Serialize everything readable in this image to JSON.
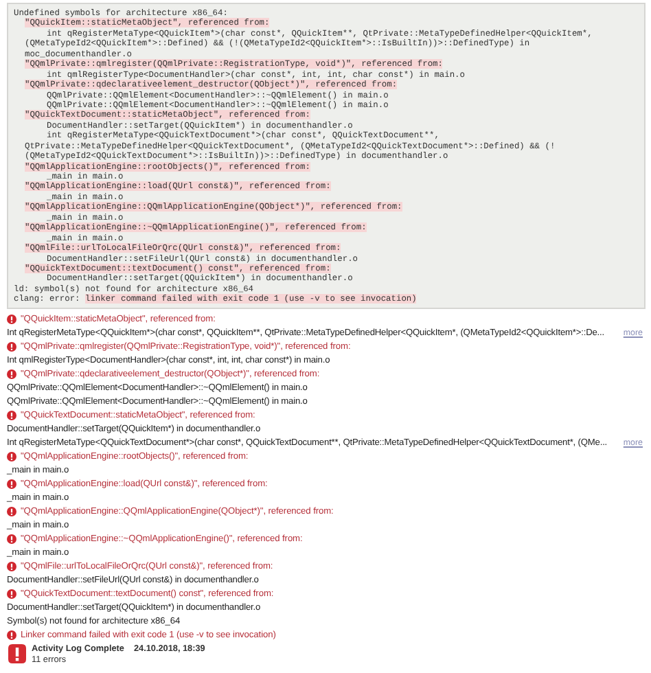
{
  "build_log": {
    "lines": [
      {
        "kind": "plain",
        "text": "Undefined symbols for architecture x86_64:"
      },
      {
        "kind": "symbol",
        "text": "\"QQuickItem::staticMetaObject\", referenced from:"
      },
      {
        "kind": "ref",
        "text": "int qRegisterMetaType<QQuickItem*>(char const*, QQuickItem**, QtPrivate::MetaTypeDefinedHelper<QQuickItem*,"
      },
      {
        "kind": "cont",
        "text": "(QMetaTypeId2<QQuickItem*>::Defined) && (!(QMetaTypeId2<QQuickItem*>::IsBuiltIn))>::DefinedType) in"
      },
      {
        "kind": "cont",
        "text": "moc_documenthandler.o"
      },
      {
        "kind": "symbol",
        "text": "\"QQmlPrivate::qmlregister(QQmlPrivate::RegistrationType, void*)\", referenced from:"
      },
      {
        "kind": "ref",
        "text": "int qmlRegisterType<DocumentHandler>(char const*, int, int, char const*) in main.o"
      },
      {
        "kind": "symbol",
        "text": "\"QQmlPrivate::qdeclarativeelement_destructor(QObject*)\", referenced from:"
      },
      {
        "kind": "ref",
        "text": "QQmlPrivate::QQmlElement<DocumentHandler>::~QQmlElement() in main.o"
      },
      {
        "kind": "ref",
        "text": "QQmlPrivate::QQmlElement<DocumentHandler>::~QQmlElement() in main.o"
      },
      {
        "kind": "symbol",
        "text": "\"QQuickTextDocument::staticMetaObject\", referenced from:"
      },
      {
        "kind": "ref",
        "text": "DocumentHandler::setTarget(QQuickItem*) in documenthandler.o"
      },
      {
        "kind": "ref",
        "text": "int qRegisterMetaType<QQuickTextDocument*>(char const*, QQuickTextDocument**,"
      },
      {
        "kind": "cont",
        "text": "QtPrivate::MetaTypeDefinedHelper<QQuickTextDocument*, (QMetaTypeId2<QQuickTextDocument*>::Defined) && (!"
      },
      {
        "kind": "cont",
        "text": "(QMetaTypeId2<QQuickTextDocument*>::IsBuiltIn))>::DefinedType) in documenthandler.o"
      },
      {
        "kind": "symbol",
        "text": "\"QQmlApplicationEngine::rootObjects()\", referenced from:"
      },
      {
        "kind": "ref",
        "text": "_main in main.o"
      },
      {
        "kind": "symbol",
        "text": "\"QQmlApplicationEngine::load(QUrl const&)\", referenced from:"
      },
      {
        "kind": "ref",
        "text": "_main in main.o"
      },
      {
        "kind": "symbol",
        "text": "\"QQmlApplicationEngine::QQmlApplicationEngine(QObject*)\", referenced from:"
      },
      {
        "kind": "ref",
        "text": "_main in main.o"
      },
      {
        "kind": "symbol",
        "text": "\"QQmlApplicationEngine::~QQmlApplicationEngine()\", referenced from:"
      },
      {
        "kind": "ref",
        "text": "_main in main.o"
      },
      {
        "kind": "symbol",
        "text": "\"QQmlFile::urlToLocalFileOrQrc(QUrl const&)\", referenced from:"
      },
      {
        "kind": "ref",
        "text": "DocumentHandler::setFileUrl(QUrl const&) in documenthandler.o"
      },
      {
        "kind": "symbol",
        "text": "\"QQuickTextDocument::textDocument() const\", referenced from:"
      },
      {
        "kind": "ref",
        "text": "DocumentHandler::setTarget(QQuickItem*) in documenthandler.o"
      },
      {
        "kind": "plain",
        "text": "ld: symbol(s) not found for architecture x86_64"
      },
      {
        "kind": "mixed",
        "prefix": "clang: error: ",
        "text": "linker command failed with exit code 1 (use -v to see invocation)"
      }
    ]
  },
  "issues": [
    {
      "kind": "error",
      "title": "\"QQuickItem::staticMetaObject\", referenced from:",
      "details": [
        {
          "text": "Int qRegisterMetaType<QQuickItem*>(char const*, QQuickItem**, QtPrivate::MetaTypeDefinedHelper<QQuickItem*, (QMetaTypeId2<QQuickItem*>::De...",
          "more": "more"
        }
      ]
    },
    {
      "kind": "error",
      "title": "\"QQmlPrivate::qmlregister(QQmlPrivate::RegistrationType, void*)\", referenced from:",
      "details": [
        {
          "text": "Int qmlRegisterType<DocumentHandler>(char const*, int, int, char const*) in main.o"
        }
      ]
    },
    {
      "kind": "error",
      "title": "\"QQmlPrivate::qdeclarativeelement_destructor(QObject*)\", referenced from:",
      "details": [
        {
          "text": "QQmlPrivate::QQmlElement<DocumentHandler>::~QQmlElement() in main.o"
        },
        {
          "text": "QQmlPrivate::QQmlElement<DocumentHandler>::~QQmlElement() in main.o"
        }
      ]
    },
    {
      "kind": "error",
      "title": "\"QQuickTextDocument::staticMetaObject\", referenced from:",
      "details": [
        {
          "text": "DocumentHandler::setTarget(QQuickItem*) in documenthandler.o"
        },
        {
          "text": "Int qRegisterMetaType<QQuickTextDocument*>(char const*, QQuickTextDocument**, QtPrivate::MetaTypeDefinedHelper<QQuickTextDocument*, (QMe...",
          "more": "more"
        }
      ]
    },
    {
      "kind": "error",
      "title": "\"QQmlApplicationEngine::rootObjects()\", referenced from:",
      "details": [
        {
          "text": "_main in main.o"
        }
      ]
    },
    {
      "kind": "error",
      "title": "\"QQmlApplicationEngine::load(QUrl const&)\", referenced from:",
      "details": [
        {
          "text": "_main in main.o"
        }
      ]
    },
    {
      "kind": "error",
      "title": "\"QQmlApplicationEngine::QQmlApplicationEngine(QObject*)\", referenced from:",
      "details": [
        {
          "text": "_main in main.o"
        }
      ]
    },
    {
      "kind": "error",
      "title": "\"QQmlApplicationEngine::~QQmlApplicationEngine()\", referenced from:",
      "details": [
        {
          "text": "_main in main.o"
        }
      ]
    },
    {
      "kind": "error",
      "title": "\"QQmlFile::urlToLocalFileOrQrc(QUrl const&)\", referenced from:",
      "details": [
        {
          "text": "DocumentHandler::setFileUrl(QUrl const&) in documenthandler.o"
        }
      ]
    },
    {
      "kind": "error",
      "title": "\"QQuickTextDocument::textDocument() const\", referenced from:",
      "details": [
        {
          "text": "DocumentHandler::setTarget(QQuickItem*) in documenthandler.o"
        }
      ]
    },
    {
      "kind": "note",
      "title": "Symbol(s) not found for architecture x86_64"
    },
    {
      "kind": "error",
      "title": "Linker command failed with exit code 1 (use -v to see invocation)"
    }
  ],
  "footer": {
    "status": "Activity Log Complete",
    "timestamp": "24.10.2018, 18:39",
    "count": "11 errors"
  }
}
